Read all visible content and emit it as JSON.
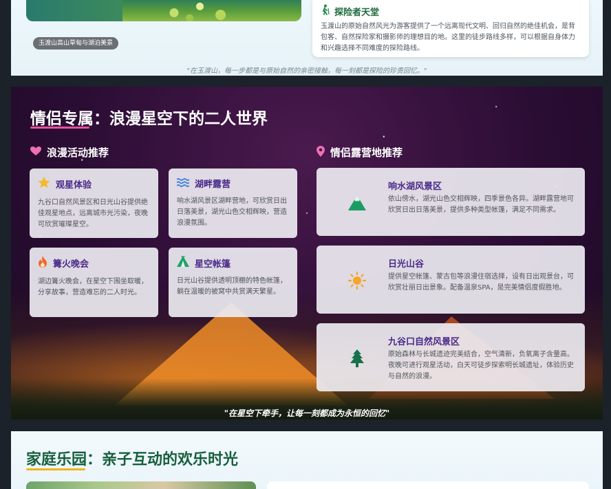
{
  "top": {
    "photo_caption": "玉渡山高山草甸与湖泊美景",
    "explorer": {
      "icon": "hiker-icon",
      "title": "探险者天堂",
      "text": "玉渡山的原始自然风光为游客提供了一个远离现代文明、回归自然的绝佳机会，是背包客、自然探险家和摄影师的理想目的地。这里的徒步路线多样，可以根据自身体力和兴趣选择不同难度的探险路线。"
    },
    "quote": "\"在玉渡山，每一步都是与原始自然的亲密接触，每一刻都是探险的珍贵回忆。\""
  },
  "couple": {
    "title": "情侣专属：浪漫星空下的二人世界",
    "activities_heading": "浪漫活动推荐",
    "campsites_heading": "情侣露营地推荐",
    "activities": [
      {
        "icon": "star-icon",
        "title": "观星体验",
        "text": "九谷口自然风景区和日光山谷提供绝佳观星地点，远离城市光污染，夜晚可欣赏璀璨星空。"
      },
      {
        "icon": "waves-icon",
        "title": "湖畔露营",
        "text": "响水湖风景区湖畔营地，可欣赏日出日落美景，湖光山色交相辉映，营造浪漫氛围。"
      },
      {
        "icon": "fire-icon",
        "title": "篝火晚会",
        "text": "湖边篝火晚会，在星空下围坐取暖，分享故事，营造难忘的二人时光。"
      },
      {
        "icon": "tent-icon",
        "title": "星空帐篷",
        "text": "日光山谷提供透明顶棚的特色帐篷，躺在温暖的被窝中共赏满天繁星。"
      }
    ],
    "campsites": [
      {
        "icon": "mountain-icon",
        "title": "响水湖风景区",
        "text": "依山傍水，湖光山色交相辉映，四季景色各异。湖畔露营地可欣赏日出日落美景，提供多种类型帐篷，满足不同需求。"
      },
      {
        "icon": "sun-icon",
        "title": "日光山谷",
        "text": "提供星空帐篷、蒙古包等浪漫住宿选择，设有日出观景台，可欣赏壮丽日出景象。配备温泉SPA，是完美情侣度假胜地。"
      },
      {
        "icon": "tree-icon",
        "title": "九谷口自然风景区",
        "text": "原始森林与长城遗迹完美结合，空气清新，负氧离子含量高。夜晚可进行观星活动，白天可徒步探索明长城遗址，体验历史与自然的浪漫。"
      }
    ],
    "quote": "\"在星空下牵手，让每一刻都成为永恒的回忆\""
  },
  "family": {
    "title": "家庭乐园：亲子互动的欢乐时光"
  },
  "colors": {
    "accent_pink": "#ef4f9f",
    "accent_purple": "#4a2a8a",
    "accent_green": "#155f3c",
    "accent_yellow": "#f2b21c"
  }
}
